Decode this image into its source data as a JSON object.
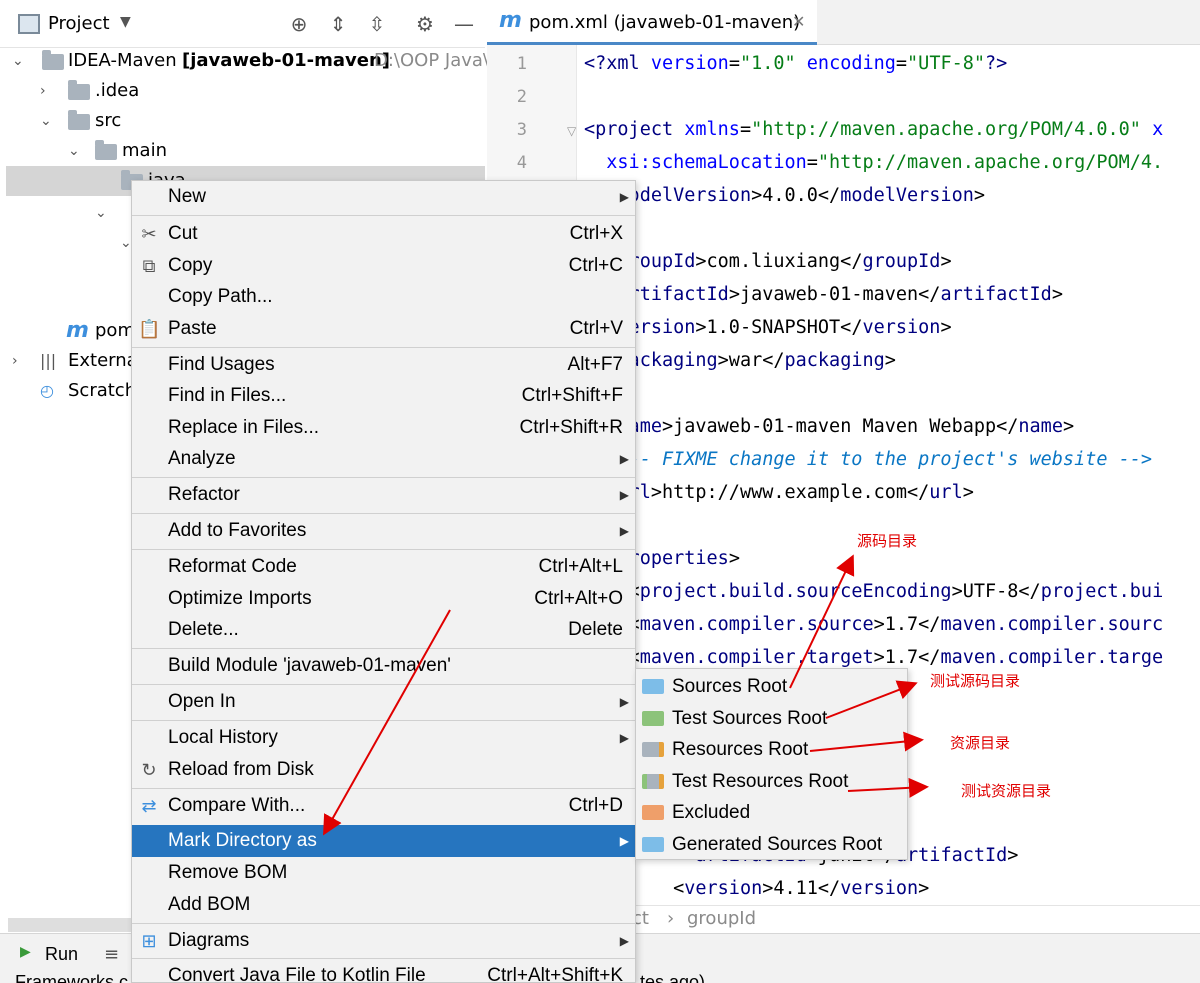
{
  "project_panel": {
    "title": "Project",
    "tree": {
      "root_label": "IDEA-Maven",
      "root_module": "[javaweb-01-maven]",
      "root_path": "D:\\OOP Java\\",
      "idea": ".idea",
      "src": "src",
      "main": "main",
      "java": "java",
      "pom": "pom",
      "external": "Externa",
      "scratch": "Scratch"
    }
  },
  "editor": {
    "tab_label": "pom.xml (javaweb-01-maven)",
    "line_numbers": [
      "1",
      "2",
      "3",
      "4"
    ],
    "breadcrumb": [
      "ct",
      "groupId"
    ]
  },
  "bottom": {
    "run_label": "Run",
    "status_text": "Frameworks c",
    "status_tail": "tes ago)"
  },
  "context_menu": {
    "items": [
      {
        "label": "New",
        "shortcut": "",
        "sub": true
      },
      {
        "label": "Cut",
        "shortcut": "Ctrl+X"
      },
      {
        "label": "Copy",
        "shortcut": "Ctrl+C"
      },
      {
        "label": "Copy Path...",
        "shortcut": ""
      },
      {
        "label": "Paste",
        "shortcut": "Ctrl+V"
      },
      {
        "label": "Find Usages",
        "shortcut": "Alt+F7"
      },
      {
        "label": "Find in Files...",
        "shortcut": "Ctrl+Shift+F"
      },
      {
        "label": "Replace in Files...",
        "shortcut": "Ctrl+Shift+R"
      },
      {
        "label": "Analyze",
        "shortcut": "",
        "sub": true
      },
      {
        "label": "Refactor",
        "shortcut": "",
        "sub": true
      },
      {
        "label": "Add to Favorites",
        "shortcut": "",
        "sub": true
      },
      {
        "label": "Reformat Code",
        "shortcut": "Ctrl+Alt+L"
      },
      {
        "label": "Optimize Imports",
        "shortcut": "Ctrl+Alt+O"
      },
      {
        "label": "Delete...",
        "shortcut": "Delete"
      },
      {
        "label": "Build Module 'javaweb-01-maven'",
        "shortcut": ""
      },
      {
        "label": "Open In",
        "shortcut": "",
        "sub": true
      },
      {
        "label": "Local History",
        "shortcut": "",
        "sub": true
      },
      {
        "label": "Reload from Disk",
        "shortcut": ""
      },
      {
        "label": "Compare With...",
        "shortcut": "Ctrl+D"
      },
      {
        "label": "Mark Directory as",
        "shortcut": "",
        "sub": true
      },
      {
        "label": "Remove BOM",
        "shortcut": ""
      },
      {
        "label": "Add BOM",
        "shortcut": ""
      },
      {
        "label": "Diagrams",
        "shortcut": "",
        "sub": true
      },
      {
        "label": "Convert Java File to Kotlin File",
        "shortcut": "Ctrl+Alt+Shift+K"
      }
    ]
  },
  "submenu": {
    "items": [
      {
        "label": "Sources Root",
        "color": "#7dbde8"
      },
      {
        "label": "Test Sources Root",
        "color": "#8cc37a"
      },
      {
        "label": "Resources Root",
        "color": "#a9b3bd"
      },
      {
        "label": "Test Resources Root",
        "color": "#a9b3bd"
      },
      {
        "label": "Excluded",
        "color": "#ef9f6a"
      },
      {
        "label": "Generated Sources Root",
        "color": "#7dbde8"
      }
    ]
  },
  "annotations": {
    "sources": "源码目录",
    "test_sources": "测试源码目录",
    "resources": "资源目录",
    "test_resources": "测试资源目录"
  },
  "colors": {
    "selection": "#2675bf",
    "annotation": "#e00000"
  }
}
